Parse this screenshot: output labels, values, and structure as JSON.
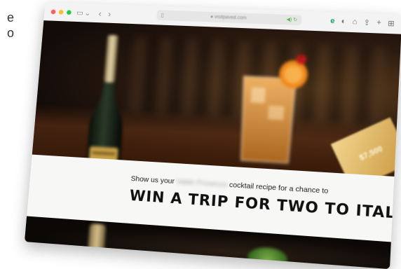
{
  "side_text": {
    "line1": "e",
    "line2": "o"
  },
  "window": {
    "colors": {
      "close": "#ff5f57",
      "minimize": "#febc2e",
      "zoom": "#28c840"
    },
    "nav": {
      "sidebar_icon": "▭",
      "chevron": "⌄",
      "back": "‹",
      "forward": "›"
    },
    "address": {
      "left_icon": "▯",
      "url": "● visitpaved.com",
      "right": "◀) ↻"
    },
    "toolbar_icons": [
      "e",
      "◐",
      "⌂",
      "⇪",
      "+",
      "⊞"
    ]
  },
  "hero": {
    "subline_before": "Show us your",
    "subline_blurred": "Valdo Prosecco",
    "subline_after": "cocktail recipe for a chance to",
    "headline": "WIN A TRIP FOR TWO TO ITALY",
    "tag_text": "$7,500"
  }
}
